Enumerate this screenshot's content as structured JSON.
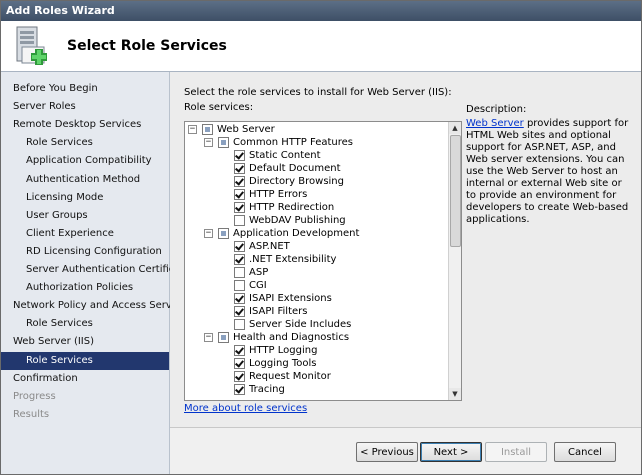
{
  "window": {
    "title": "Add Roles Wizard"
  },
  "header": {
    "title": "Select Role Services",
    "icon": "server-roles-add-icon"
  },
  "sidebar": {
    "items": [
      {
        "label": "Before You Begin",
        "level": 0
      },
      {
        "label": "Server Roles",
        "level": 0
      },
      {
        "label": "Remote Desktop Services",
        "level": 0
      },
      {
        "label": "Role Services",
        "level": 1
      },
      {
        "label": "Application Compatibility",
        "level": 1
      },
      {
        "label": "Authentication Method",
        "level": 1
      },
      {
        "label": "Licensing Mode",
        "level": 1
      },
      {
        "label": "User Groups",
        "level": 1
      },
      {
        "label": "Client Experience",
        "level": 1
      },
      {
        "label": "RD Licensing Configuration",
        "level": 1
      },
      {
        "label": "Server Authentication Certificate",
        "level": 1
      },
      {
        "label": "Authorization Policies",
        "level": 1
      },
      {
        "label": "Network Policy and Access Services",
        "level": 0
      },
      {
        "label": "Role Services",
        "level": 1
      },
      {
        "label": "Web Server (IIS)",
        "level": 0
      },
      {
        "label": "Role Services",
        "level": 1,
        "selected": true
      },
      {
        "label": "Confirmation",
        "level": 0
      },
      {
        "label": "Progress",
        "level": 0,
        "disabled": true
      },
      {
        "label": "Results",
        "level": 0,
        "disabled": true
      }
    ]
  },
  "main": {
    "instruction": "Select the role services to install for Web Server (IIS):",
    "role_services_label": "Role services:",
    "tree": [
      {
        "label": "Web Server",
        "level": 0,
        "expander": "−",
        "state": "partial"
      },
      {
        "label": "Common HTTP Features",
        "level": 1,
        "expander": "−",
        "state": "partial"
      },
      {
        "label": "Static Content",
        "level": 2,
        "state": "checked"
      },
      {
        "label": "Default Document",
        "level": 2,
        "state": "checked"
      },
      {
        "label": "Directory Browsing",
        "level": 2,
        "state": "checked"
      },
      {
        "label": "HTTP Errors",
        "level": 2,
        "state": "checked"
      },
      {
        "label": "HTTP Redirection",
        "level": 2,
        "state": "checked"
      },
      {
        "label": "WebDAV Publishing",
        "level": 2,
        "state": "unchecked"
      },
      {
        "label": "Application Development",
        "level": 1,
        "expander": "−",
        "state": "partial"
      },
      {
        "label": "ASP.NET",
        "level": 2,
        "state": "checked"
      },
      {
        "label": ".NET Extensibility",
        "level": 2,
        "state": "checked"
      },
      {
        "label": "ASP",
        "level": 2,
        "state": "unchecked"
      },
      {
        "label": "CGI",
        "level": 2,
        "state": "unchecked"
      },
      {
        "label": "ISAPI Extensions",
        "level": 2,
        "state": "checked"
      },
      {
        "label": "ISAPI Filters",
        "level": 2,
        "state": "checked"
      },
      {
        "label": "Server Side Includes",
        "level": 2,
        "state": "unchecked"
      },
      {
        "label": "Health and Diagnostics",
        "level": 1,
        "expander": "−",
        "state": "partial"
      },
      {
        "label": "HTTP Logging",
        "level": 2,
        "state": "checked"
      },
      {
        "label": "Logging Tools",
        "level": 2,
        "state": "checked"
      },
      {
        "label": "Request Monitor",
        "level": 2,
        "state": "checked"
      },
      {
        "label": "Tracing",
        "level": 2,
        "state": "checked"
      }
    ],
    "more_link": "More about role services",
    "description": {
      "title": "Description:",
      "link": "Web Server",
      "text": " provides support for HTML Web sites and optional support for ASP.NET, ASP, and Web server extensions. You can use the Web Server to host an internal or external Web site or to provide an environment for developers to create Web-based applications."
    }
  },
  "buttons": {
    "previous": "< Previous",
    "next": "Next >",
    "install": "Install",
    "cancel": "Cancel"
  }
}
